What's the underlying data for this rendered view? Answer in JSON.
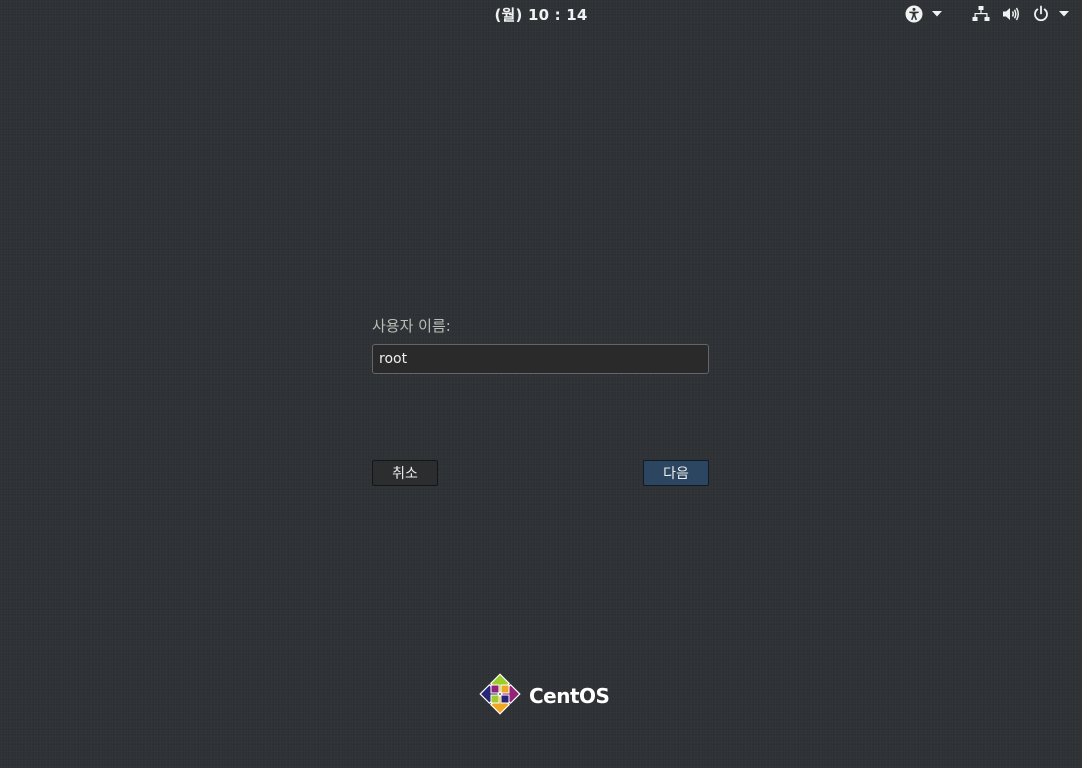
{
  "top_bar": {
    "clock": "(월) 10 : 14",
    "icons": {
      "accessibility": "accessibility-icon",
      "network": "network-wired-icon",
      "volume": "volume-icon",
      "power": "power-icon",
      "dropdown": "chevron-down-icon"
    }
  },
  "login": {
    "username_label": "사용자 이름:",
    "username_value": "root",
    "cancel_label": "취소",
    "next_label": "다음"
  },
  "branding": {
    "logo_text": "CentOS",
    "colors": {
      "yellow": "#efa724",
      "green": "#9ccd2a",
      "purple": "#932279",
      "blue": "#262577"
    }
  },
  "colors": {
    "background": "#2e3235",
    "next_button": "#2c4560",
    "label_text": "#babdb6"
  }
}
